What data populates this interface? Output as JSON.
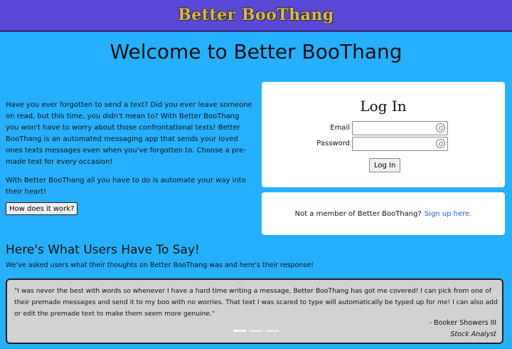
{
  "header": {
    "brand": "Better BooThang"
  },
  "welcome": {
    "title": "Welcome to Better BooThang"
  },
  "intro": {
    "p1": "Have you ever forgotten to send a text? Did you ever leave someone on read, but this time, you didn't mean to? With Better BooThang you won't have to worry about those confrontational texts! Better BooThang is an automated messaging app that sends your loved ones texts messages even when you've forgotten to. Choose a pre-made text for every occasion!",
    "p2": "With Better BooThang all you have to do is automate your way into their heart!",
    "button": "How does it work?"
  },
  "login": {
    "title": "Log In",
    "email_label": "Email",
    "password_label": "Password",
    "email_value": "",
    "password_value": "",
    "button": "Log In"
  },
  "signup": {
    "text": "Not a member of Better BooThang?",
    "link": "Sign up here."
  },
  "testimonials": {
    "heading": "Here's What Users Have To Say!",
    "subtitle": "We've asked users what their thoughts on Better BooThang was and here's their response!",
    "quote": "\"I was never the best with words so whenever I have a hard time writing a message, Better BooThang has got me covered! I can pick from one of their premade messages and send it to my boo with no worries. That text I was scared to type will automatically be typed up for me! I can also add or edit the premade text to make them seem more genuine.\"",
    "author": "- Booker Showers III",
    "role": "Stock Analyst",
    "slides_count": 3,
    "active_slide": 1
  },
  "icons": {
    "field_icon": "password-manager-icon"
  }
}
